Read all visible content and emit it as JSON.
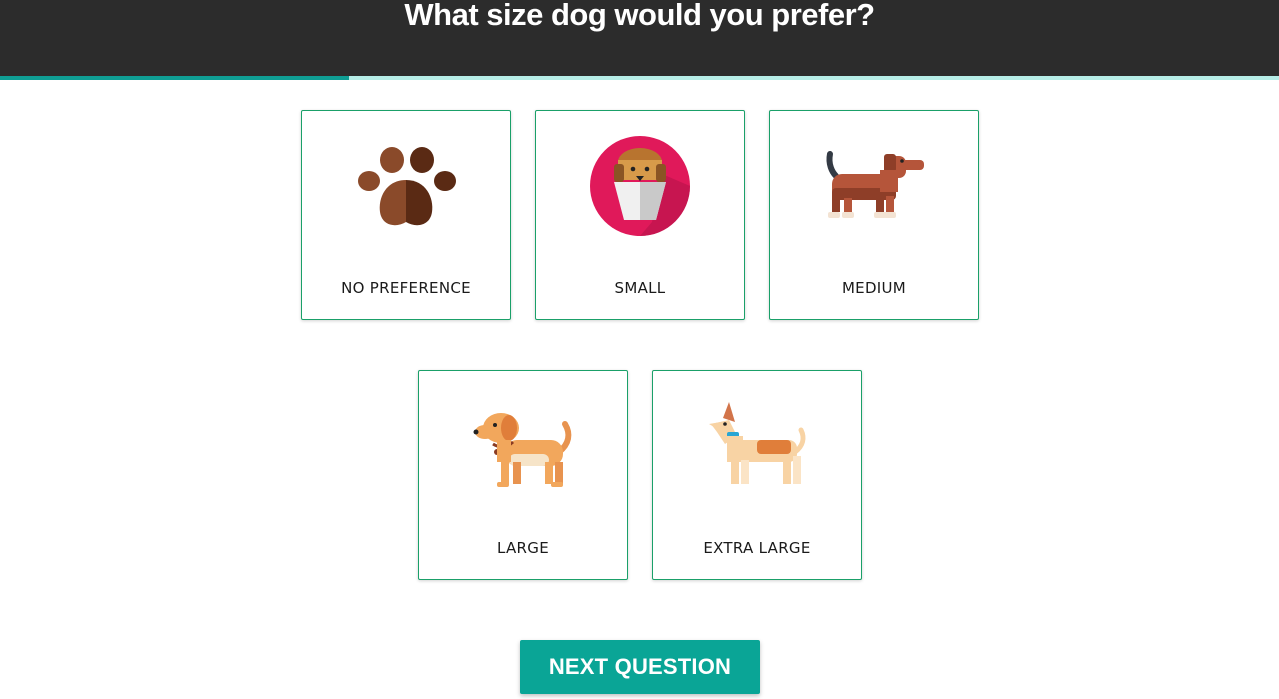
{
  "header": {
    "title": "What size dog would you prefer?"
  },
  "progress": {
    "fraction": 0.273,
    "fill_color": "#0f9e94",
    "track_color": "#b6ede7"
  },
  "options": [
    {
      "id": "no-preference",
      "label": "NO PREFERENCE",
      "icon": "paw-icon"
    },
    {
      "id": "small",
      "label": "SMALL",
      "icon": "small-dog-icon"
    },
    {
      "id": "medium",
      "label": "MEDIUM",
      "icon": "medium-dog-icon"
    },
    {
      "id": "large",
      "label": "LARGE",
      "icon": "large-dog-icon"
    },
    {
      "id": "extra-large",
      "label": "EXTRA LARGE",
      "icon": "extra-large-dog-icon"
    }
  ],
  "next_button": {
    "label": "NEXT QUESTION",
    "color": "#0aa596"
  },
  "colors": {
    "header_bg": "#2c2c2c",
    "card_border": "#1aa069"
  }
}
